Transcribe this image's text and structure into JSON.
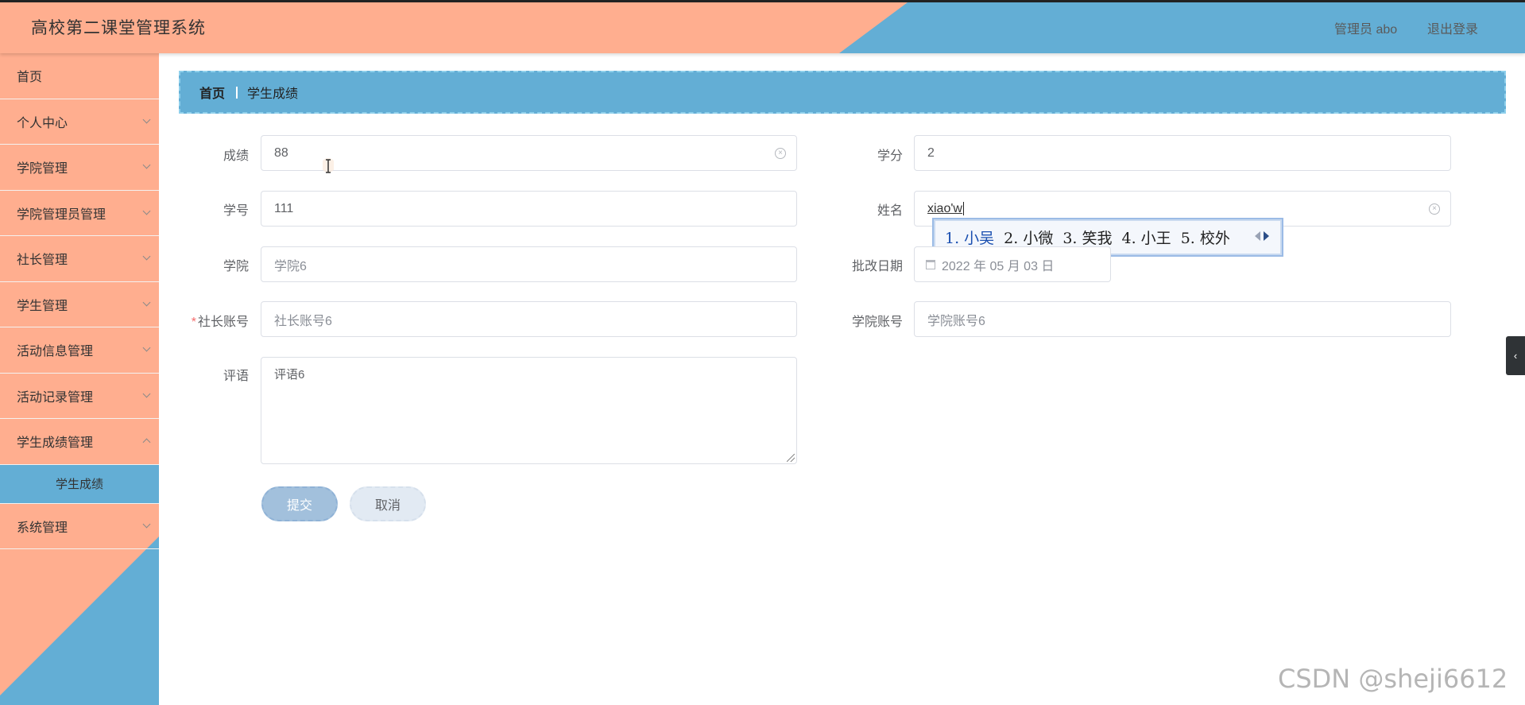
{
  "header": {
    "title": "高校第二课堂管理系统",
    "user": "管理员 abo",
    "logout": "退出登录"
  },
  "sidebar": {
    "items": [
      {
        "label": "首页"
      },
      {
        "label": "个人中心"
      },
      {
        "label": "学院管理"
      },
      {
        "label": "学院管理员管理"
      },
      {
        "label": "社长管理"
      },
      {
        "label": "学生管理"
      },
      {
        "label": "活动信息管理"
      },
      {
        "label": "活动记录管理"
      },
      {
        "label": "学生成绩管理"
      },
      {
        "label": "学生成绩"
      },
      {
        "label": "系统管理"
      }
    ]
  },
  "breadcrumb": {
    "home": "首页",
    "current": "学生成绩"
  },
  "form": {
    "score_label": "成绩",
    "score_value": "88",
    "credit_label": "学分",
    "credit_value": "2",
    "student_no_label": "学号",
    "student_no_value": "111",
    "name_label": "姓名",
    "name_value": "xiao'w",
    "college_label": "学院",
    "college_value": "学院6",
    "review_date_label": "批改日期",
    "review_date_value": "2022 年 05 月 03 日",
    "president_account_label": "社长账号",
    "president_account_value": "社长账号6",
    "required_mark": "*",
    "college_account_label": "学院账号",
    "college_account_value": "学院账号6",
    "comment_label": "评语",
    "comment_value": "评语6",
    "submit": "提交",
    "cancel": "取消"
  },
  "ime": {
    "candidates": [
      "1. 小吴",
      "2. 小微",
      "3. 笑我",
      "4. 小王",
      "5. 校外"
    ]
  },
  "side_toggle": "‹",
  "watermark": "CSDN @sheji6612",
  "colors": {
    "peach": "#ffae8f",
    "blue": "#63aed5"
  }
}
